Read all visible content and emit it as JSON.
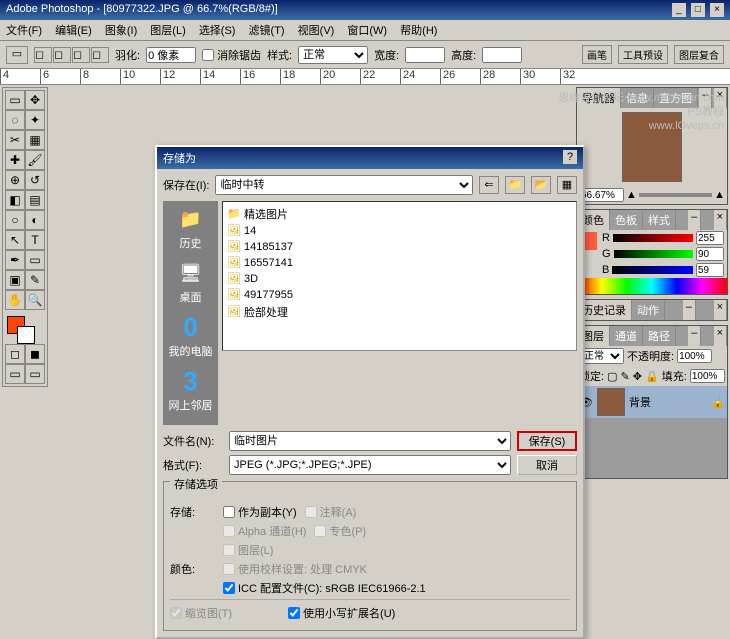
{
  "app": {
    "title": "Adobe Photoshop - [80977322.JPG @ 66.7%(RGB/8#)]"
  },
  "menu": [
    "文件(F)",
    "编辑(E)",
    "图象(I)",
    "图层(L)",
    "选择(S)",
    "滤镜(T)",
    "视图(V)",
    "窗口(W)",
    "帮助(H)"
  ],
  "options": {
    "feather_label": "羽化:",
    "feather_value": "0 像素",
    "antialias": "消除锯齿",
    "style_label": "样式:",
    "style_value": "正常",
    "width_label": "宽度:",
    "height_label": "高度:",
    "tabs": [
      "画笔",
      "工具预设",
      "图层复合"
    ]
  },
  "ruler": [
    "4",
    "6",
    "8",
    "10",
    "12",
    "14",
    "16",
    "18",
    "20",
    "22",
    "24",
    "26",
    "28",
    "30",
    "32"
  ],
  "navigator": {
    "tabs": [
      "导航器",
      "信息",
      "直方图"
    ],
    "zoom": "66.67%"
  },
  "color": {
    "tabs": [
      "颜色",
      "色板",
      "样式"
    ],
    "r": "255",
    "g": "90",
    "b": "59"
  },
  "history": {
    "tabs": [
      "历史记录",
      "动作"
    ]
  },
  "layers": {
    "tabs": [
      "图层",
      "通道",
      "路径"
    ],
    "mode": "正常",
    "opacity_label": "不透明度:",
    "opacity": "100%",
    "lock_label": "锁定:",
    "fill_label": "填充:",
    "fill": "100%",
    "layer_name": "背景"
  },
  "dialog": {
    "title": "存储为",
    "savein_label": "保存在(I):",
    "savein_value": "临时中转",
    "places": [
      {
        "icon": "📁",
        "label": "历史"
      },
      {
        "icon": "🖥",
        "label": "桌面"
      },
      {
        "icon": "0",
        "label": "我的电脑",
        "big": true
      },
      {
        "icon": "3",
        "label": "网上邻居",
        "big": true
      }
    ],
    "files": [
      "精选图片",
      "14",
      "14185137",
      "16557141",
      "3D",
      "49177955",
      "脸部处理"
    ],
    "filename_label": "文件名(N):",
    "filename_value": "临时图片",
    "format_label": "格式(F):",
    "format_value": "JPEG (*.JPG;*.JPEG;*.JPE)",
    "save_btn": "保存(S)",
    "cancel_btn": "取消",
    "options_title": "存储选项",
    "storage_label": "存储:",
    "opt_copy": "作为副本(Y)",
    "opt_notes": "注释(A)",
    "opt_alpha": "Alpha 通道(H)",
    "opt_spot": "专色(P)",
    "opt_layers": "图层(L)",
    "color_label": "颜色:",
    "opt_proof": "使用校样设置: 处理 CMYK",
    "opt_icc": "ICC 配置文件(C): sRGB IEC61966-2.1",
    "opt_thumb": "缩览图(T)",
    "opt_lowercase": "使用小写扩展名(U)"
  },
  "watermark": {
    "l1": "思缘设计论坛  www.missyuan.com",
    "l2": "PS教程",
    "l3": "www.lOveps.cn"
  }
}
